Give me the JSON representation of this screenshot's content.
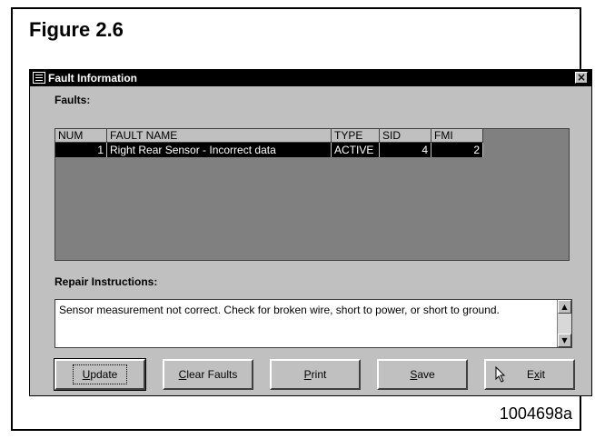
{
  "figure": {
    "title": "Figure 2.6",
    "id": "1004698a"
  },
  "window": {
    "title": "Fault Information",
    "close_icon": "close-icon",
    "app_icon": "app-icon"
  },
  "faults": {
    "label": "Faults:",
    "columns": [
      "NUM",
      "FAULT NAME",
      "TYPE",
      "SID",
      "FMI"
    ],
    "rows": [
      {
        "num": "1",
        "fault_name": "Right Rear Sensor - Incorrect data",
        "type": "ACTIVE",
        "sid": "4",
        "fmi": "2"
      }
    ]
  },
  "repair": {
    "label": "Repair Instructions:",
    "text": "Sensor measurement not correct.  Check for broken wire, short to power, or short to ground."
  },
  "buttons": {
    "update": {
      "mnemonic": "U",
      "rest": "pdate"
    },
    "clear_faults": {
      "mnemonic": "C",
      "rest": "lear Faults"
    },
    "print": {
      "mnemonic": "P",
      "rest": "rint"
    },
    "save": {
      "mnemonic": "S",
      "rest": "ave"
    },
    "exit": {
      "pre": "E",
      "mnemonic": "x",
      "rest": "it"
    }
  }
}
